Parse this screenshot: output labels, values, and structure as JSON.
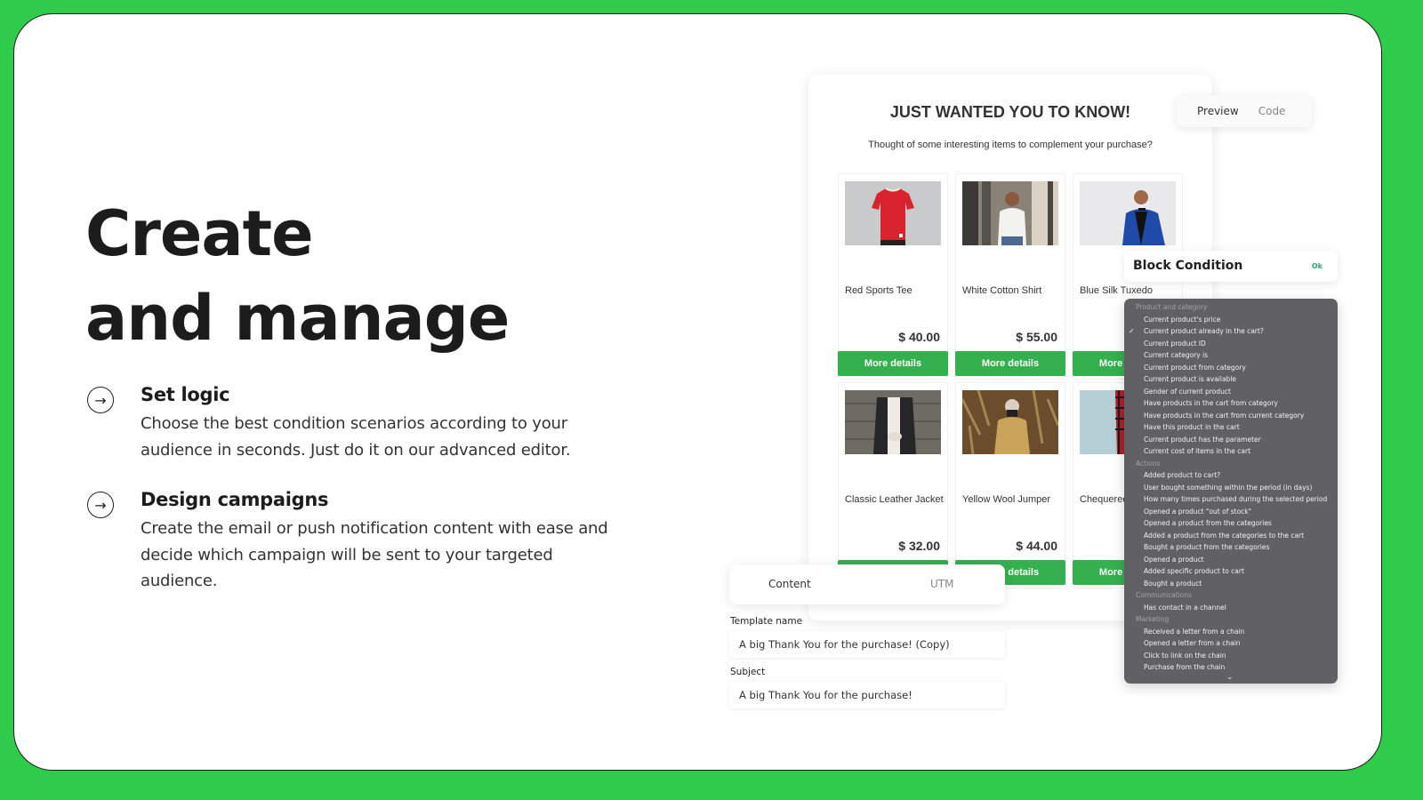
{
  "hero": {
    "title_line1": "Create",
    "title_line2": "and manage"
  },
  "features": [
    {
      "icon": "arrow-right-circle-icon",
      "title": "Set logic",
      "description": "Choose the best condition scenarios according to your audience in seconds. Just do it on our advanced editor."
    },
    {
      "icon": "arrow-right-circle-icon",
      "title": "Design campaigns",
      "description": "Create the email or push notification content with ease and decide which campaign will be sent to your targeted audience."
    }
  ],
  "email_preview": {
    "title": "JUST WANTED YOU TO KNOW!",
    "subtitle": "Thought of some interesting items to complement your purchase?",
    "products": [
      {
        "name": "Red Sports Tee",
        "price": "$ 40.00",
        "button": "More details",
        "image": "red-tee"
      },
      {
        "name": "White Cotton Shirt",
        "price": "$ 55.00",
        "button": "More details",
        "image": "white-shirt"
      },
      {
        "name": "Blue Silk Tuxedo",
        "price": "",
        "button": "More details",
        "image": "blue-tuxedo"
      },
      {
        "name": "Classic Leather Jacket",
        "price": "$ 32.00",
        "button": "More details",
        "image": "leather-jacket"
      },
      {
        "name": "Yellow Wool Jumper",
        "price": "$ 44.00",
        "button": "More details",
        "image": "yellow-jumper"
      },
      {
        "name": "Chequered",
        "price": "",
        "button": "More details",
        "image": "chequered-shirt"
      }
    ]
  },
  "view_toggle": {
    "preview": "Preview",
    "code": "Code",
    "active": "Preview"
  },
  "block_condition": {
    "title": "Block Condition",
    "ok_label": "Ok"
  },
  "condition_dropdown": {
    "selected": "Current product already in the cart?",
    "groups": [
      {
        "label": "Product and category",
        "options": [
          "Current product's price",
          "Current product already in the cart?",
          "Current product ID",
          "Current category is",
          "Current product from category",
          "Current product is available",
          "Gender of current product",
          "Have products in the cart from category",
          "Have products in the cart from current category",
          "Have this product in the cart",
          "Current product has the parameter",
          "Current cost of items in the cart"
        ]
      },
      {
        "label": "Actions",
        "options": [
          "Added product to cart?",
          "User bought something within the period (in days)",
          "How many times purchased during the selected period",
          "Opened a product \"out of stock\"",
          "Opened a product from the categories",
          "Added a product from the categories to the cart",
          "Bought a product from the categories",
          "Opened a product",
          "Added specific product to cart",
          "Bought a product"
        ]
      },
      {
        "label": "Communications",
        "options": [
          "Has contact in a channel"
        ]
      },
      {
        "label": "Marketing",
        "options": [
          "Received a letter from a chain",
          "Opened a letter from a chain",
          "Click to link on the chain",
          "Purchase from the chain"
        ]
      }
    ]
  },
  "editor_tabs": {
    "content": "Content",
    "utm": "UTM",
    "active": "Content"
  },
  "form": {
    "template_name_label": "Template name",
    "template_name_value": "A big Thank You for the purchase! (Copy)",
    "subject_label": "Subject",
    "subject_value": "A big Thank You for the purchase!"
  },
  "colors": {
    "brand_green": "#2ecc4a",
    "button_green": "#34b04e",
    "ok_green": "#2aa57a",
    "dropdown_bg": "#616163"
  }
}
